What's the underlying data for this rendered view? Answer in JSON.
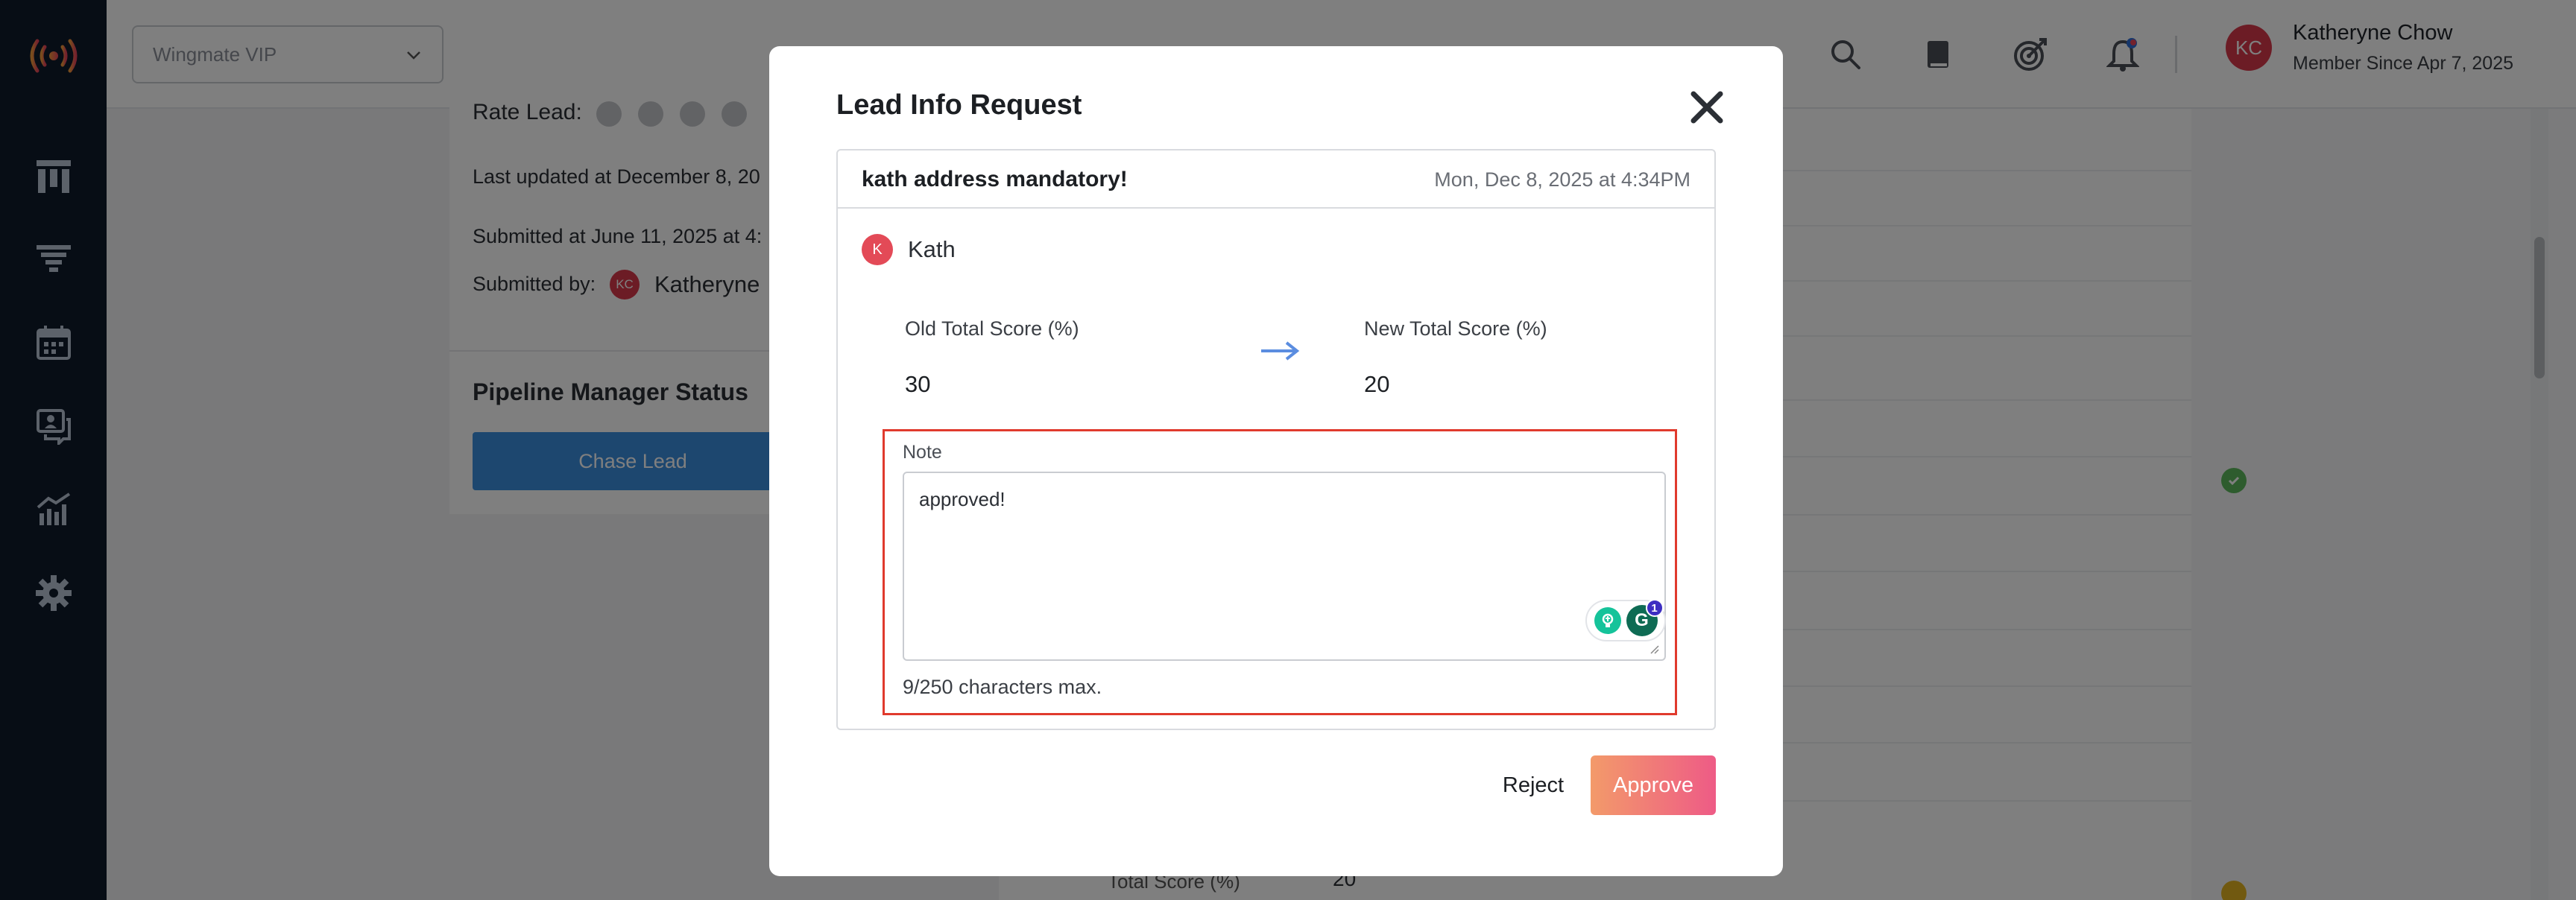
{
  "topbar": {
    "org_select": "Wingmate VIP",
    "user_initials": "KC",
    "user_name": "Katheryne Chow",
    "member_since": "Member Since Apr 7, 2025"
  },
  "sidebar": {
    "items": [
      {
        "icon": "dashboard-icon"
      },
      {
        "icon": "funnel-icon"
      },
      {
        "icon": "calendar-icon"
      },
      {
        "icon": "chat-icon"
      },
      {
        "icon": "analytics-icon"
      },
      {
        "icon": "gear-icon"
      }
    ]
  },
  "background": {
    "rate_lead": "Rate Lead:",
    "last_updated": "Last updated at December 8, 20",
    "submitted_at": "Submitted at June 11, 2025 at 4:",
    "submitted_by_label": "Submitted by:",
    "submitted_by_initials": "KC",
    "submitted_by_name": "Katheryne",
    "pipeline_title": "Pipeline Manager Status",
    "chase_lead": "Chase Lead",
    "total_score_label": "Total Score (%)",
    "total_score_value": "20"
  },
  "modal": {
    "title": "Lead Info Request",
    "subject": "kath address mandatory!",
    "date": "Mon, Dec 8, 2025 at 4:34PM",
    "requester_initial": "K",
    "requester_name": "Kath",
    "old_score_label": "Old Total Score (%)",
    "old_score_value": "30",
    "new_score_label": "New Total Score (%)",
    "new_score_value": "20",
    "note_label": "Note",
    "note_value": "approved!",
    "char_count": "9/250 characters max.",
    "grammarly_badge": "1",
    "reject_label": "Reject",
    "approve_label": "Approve"
  },
  "colors": {
    "sidebar_bg": "#0e1a2b",
    "approve_gradient_start": "#f39a6a",
    "approve_gradient_end": "#ee5b86",
    "note_highlight": "#e03a2d",
    "avatar_red": "#d9394a"
  }
}
